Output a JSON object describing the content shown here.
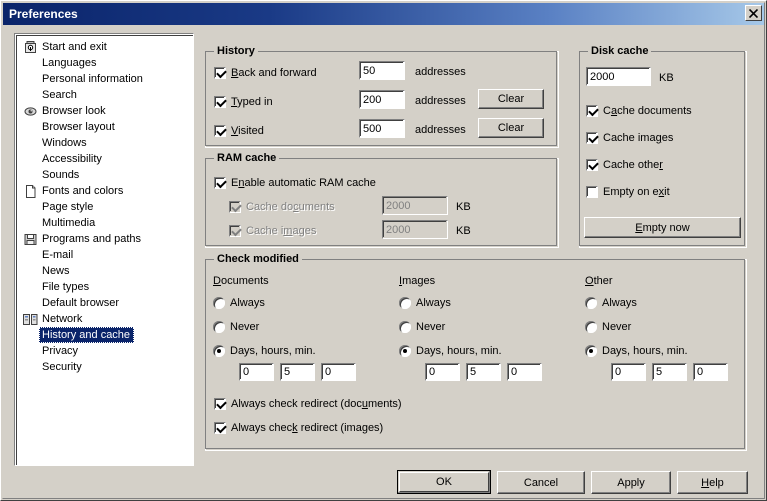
{
  "window": {
    "title": "Preferences",
    "close_label": "✕"
  },
  "sidebar": {
    "items": [
      {
        "label": "Start and exit",
        "icon": "safe-icon",
        "has_icon": true,
        "selected": false
      },
      {
        "label": "Languages",
        "icon": "",
        "has_icon": false,
        "selected": false
      },
      {
        "label": "Personal information",
        "icon": "",
        "has_icon": false,
        "selected": false
      },
      {
        "label": "Search",
        "icon": "",
        "has_icon": false,
        "selected": false
      },
      {
        "label": "Browser look",
        "icon": "eye-icon",
        "has_icon": true,
        "selected": false
      },
      {
        "label": "Browser layout",
        "icon": "",
        "has_icon": false,
        "selected": false
      },
      {
        "label": "Windows",
        "icon": "",
        "has_icon": false,
        "selected": false
      },
      {
        "label": "Accessibility",
        "icon": "",
        "has_icon": false,
        "selected": false
      },
      {
        "label": "Sounds",
        "icon": "",
        "has_icon": false,
        "selected": false
      },
      {
        "label": "Fonts and colors",
        "icon": "page-icon",
        "has_icon": true,
        "selected": false
      },
      {
        "label": "Page style",
        "icon": "",
        "has_icon": false,
        "selected": false
      },
      {
        "label": "Multimedia",
        "icon": "",
        "has_icon": false,
        "selected": false
      },
      {
        "label": "Programs and paths",
        "icon": "floppy-icon",
        "has_icon": true,
        "selected": false
      },
      {
        "label": "E-mail",
        "icon": "",
        "has_icon": false,
        "selected": false
      },
      {
        "label": "News",
        "icon": "",
        "has_icon": false,
        "selected": false
      },
      {
        "label": "File types",
        "icon": "",
        "has_icon": false,
        "selected": false
      },
      {
        "label": "Default browser",
        "icon": "",
        "has_icon": false,
        "selected": false
      },
      {
        "label": "Network",
        "icon": "network-icon",
        "has_icon": true,
        "selected": false
      },
      {
        "label": "History and cache",
        "icon": "",
        "has_icon": false,
        "selected": true
      },
      {
        "label": "Privacy",
        "icon": "",
        "has_icon": false,
        "selected": false
      },
      {
        "label": "Security",
        "icon": "",
        "has_icon": false,
        "selected": false
      }
    ]
  },
  "history": {
    "title": "History",
    "back_forward": {
      "label": "Back and forward",
      "checked": true,
      "value": "50",
      "unit": "addresses"
    },
    "typed_in": {
      "label": "Typed in",
      "checked": true,
      "value": "200",
      "unit": "addresses",
      "button": "Clear"
    },
    "visited": {
      "label": "Visited",
      "checked": true,
      "value": "500",
      "unit": "addresses",
      "button": "Clear"
    }
  },
  "ram_cache": {
    "title": "RAM cache",
    "enable": {
      "label": "Enable automatic RAM cache",
      "checked": true
    },
    "cache_documents": {
      "label": "Cache documents",
      "checked": true,
      "value": "2000",
      "unit": "KB",
      "disabled": true
    },
    "cache_images": {
      "label": "Cache images",
      "checked": true,
      "value": "2000",
      "unit": "KB",
      "disabled": true
    }
  },
  "disk_cache": {
    "title": "Disk cache",
    "size_value": "2000",
    "size_unit": "KB",
    "cache_documents": {
      "label": "Cache documents",
      "checked": true
    },
    "cache_images": {
      "label": "Cache images",
      "checked": true
    },
    "cache_other": {
      "label": "Cache other",
      "checked": true
    },
    "empty_on_exit": {
      "label": "Empty on exit",
      "checked": false
    },
    "empty_now_button": "Empty now"
  },
  "check_modified": {
    "title": "Check modified",
    "columns": [
      {
        "header": "Documents",
        "options": [
          {
            "label": "Always",
            "selected": false
          },
          {
            "label": "Never",
            "selected": false
          },
          {
            "label": "Days, hours, min.",
            "selected": true
          }
        ],
        "days": "0",
        "hours": "5",
        "minutes": "0"
      },
      {
        "header": "Images",
        "options": [
          {
            "label": "Always",
            "selected": false
          },
          {
            "label": "Never",
            "selected": false
          },
          {
            "label": "Days, hours, min.",
            "selected": true
          }
        ],
        "days": "0",
        "hours": "5",
        "minutes": "0"
      },
      {
        "header": "Other",
        "options": [
          {
            "label": "Always",
            "selected": false
          },
          {
            "label": "Never",
            "selected": false
          },
          {
            "label": "Days, hours, min.",
            "selected": true
          }
        ],
        "days": "0",
        "hours": "5",
        "minutes": "0"
      }
    ],
    "redirect_documents": {
      "label": "Always check redirect (documents)",
      "checked": true
    },
    "redirect_images": {
      "label": "Always check redirect (images)",
      "checked": true
    }
  },
  "footer": {
    "ok": "OK",
    "cancel": "Cancel",
    "apply": "Apply",
    "help": "Help"
  }
}
